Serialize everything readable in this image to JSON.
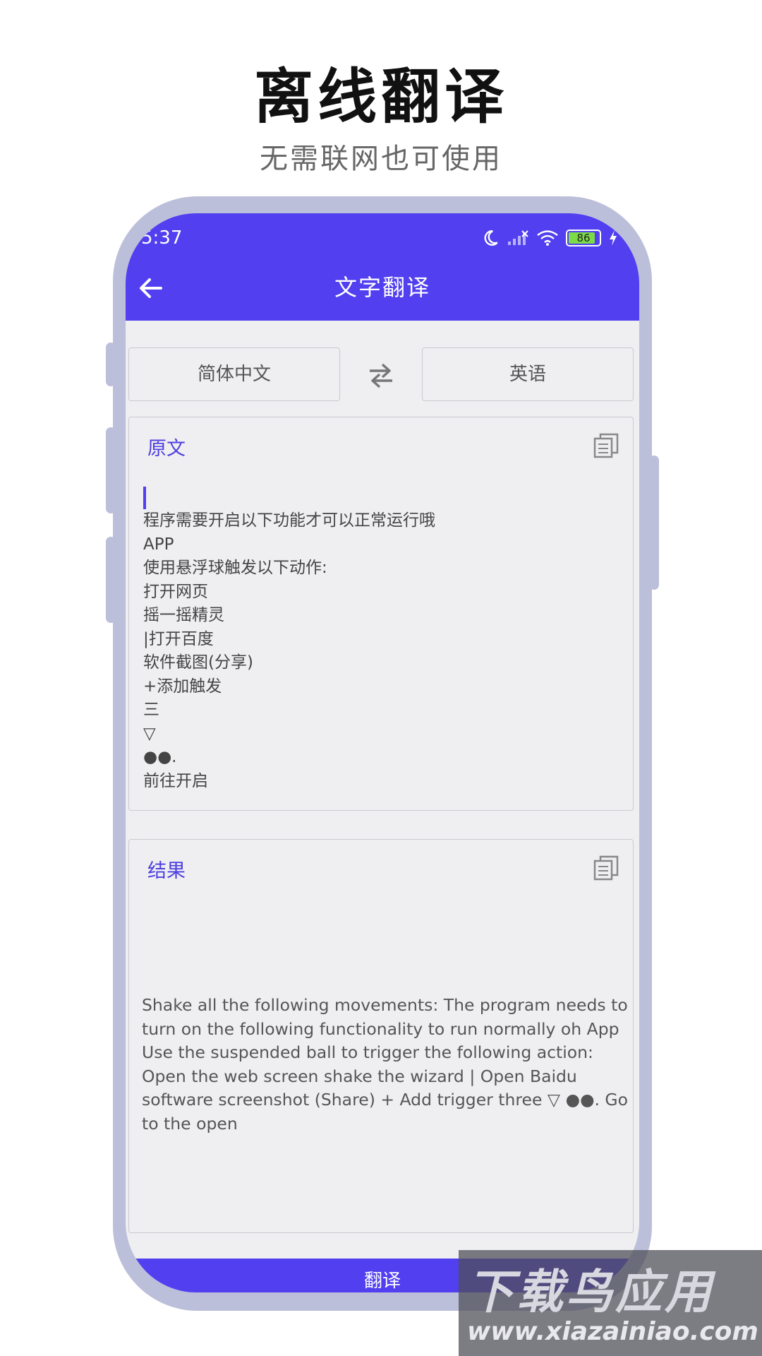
{
  "promo": {
    "headline": "离线翻译",
    "subline": "无需联网也可使用"
  },
  "status_bar": {
    "time": "5:37",
    "battery": "86",
    "icons": [
      "moon-icon",
      "signal-icon",
      "wifi-icon",
      "battery-icon",
      "charging-icon"
    ]
  },
  "app_bar": {
    "title": "文字翻译",
    "back_icon": "back-arrow-icon"
  },
  "languages": {
    "source": "简体中文",
    "target": "英语",
    "swap_icon": "swap-icon"
  },
  "source_card": {
    "label": "原文",
    "lines": [
      "程序需要开启以下功能才可以正常运行哦",
      "APP",
      "使用悬浮球触发以下动作:",
      "打开网页",
      "摇一摇精灵",
      "|打开百度",
      "软件截图(分享)",
      "+添加触发",
      "三",
      "▽",
      "●●.",
      "前往开启"
    ]
  },
  "result_card": {
    "label": "结果",
    "text": "Shake all the following movements: The program needs to turn on the following functionality to run normally oh App Use the suspended ball to trigger the following action: Open the web screen shake the wizard | Open Baidu software screenshot (Share) + Add trigger three ▽ ●●. Go to the open"
  },
  "translate_button": "翻译",
  "watermark": {
    "title": "下载鸟应用",
    "url": "www.xiazainiao.com"
  },
  "colors": {
    "accent": "#513ff0",
    "label": "#4e3ee0",
    "frame": "#bcbfd9",
    "background": "#efeff2"
  }
}
